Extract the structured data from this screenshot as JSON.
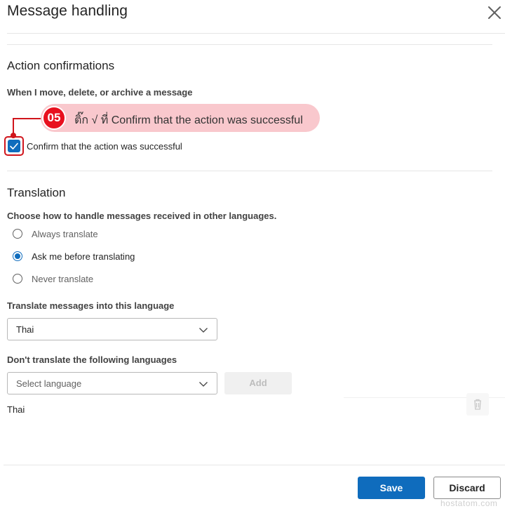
{
  "dialog": {
    "title": "Message handling"
  },
  "action_confirmations": {
    "heading": "Action confirmations",
    "subheading": "When I move, delete, or archive a message",
    "checkbox_label": "Confirm that the action was successful",
    "checked": true
  },
  "annotation": {
    "step": "05",
    "text": "ติ๊ก √ ที่ Confirm that the action was successful"
  },
  "translation": {
    "heading": "Translation",
    "question": "Choose how to handle messages received in other languages.",
    "options": [
      {
        "label": "Always translate",
        "selected": false
      },
      {
        "label": "Ask me before translating",
        "selected": true
      },
      {
        "label": "Never translate",
        "selected": false
      }
    ],
    "target_label": "Translate messages into this language",
    "target_value": "Thai",
    "exclude_label": "Don't translate the following languages",
    "exclude_placeholder": "Select language",
    "add_label": "Add",
    "excluded_languages": [
      "Thai"
    ]
  },
  "footer": {
    "save_label": "Save",
    "discard_label": "Discard"
  },
  "watermark": "hostatom.com",
  "colors": {
    "accent": "#0f6cbd",
    "annotation_red": "#e8101e",
    "annotation_bg": "#f9c8cd"
  }
}
